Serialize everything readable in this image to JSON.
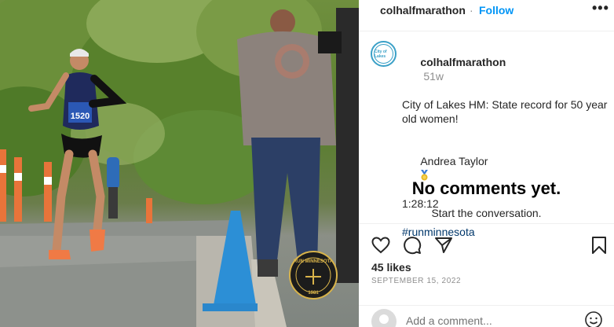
{
  "post": {
    "author": "colhalfmarathon",
    "separator": "·",
    "follow_label": "Follow",
    "more_label": "•••",
    "avatar_text": "City of Lakes",
    "caption_username": "colhalfmarathon",
    "time_ago": "51w",
    "caption_line1": "City of Lakes HM: State record for 50 year old women!",
    "caption_name": "Andrea Taylor",
    "caption_time": "1:28:12",
    "hashtag": "#runminnesota",
    "no_comments_title": "No comments yet.",
    "no_comments_sub": "Start the conversation.",
    "likes": "45 likes",
    "date": "SEPTEMBER 15, 2022",
    "comment_placeholder": "Add a comment..."
  },
  "photo": {
    "bib_number": "1520",
    "watermark_top": "RUN MINNESOTA",
    "watermark_year": "1981"
  },
  "icons": {
    "like": "heart-icon",
    "comment": "comment-icon",
    "share": "paper-plane-icon",
    "save": "bookmark-icon",
    "emoji": "smiley-icon",
    "more": "more-icon"
  },
  "colors": {
    "follow_blue": "#0095f6",
    "hashtag_blue": "#00376b",
    "muted_gray": "#8e8e8e",
    "watermark_gold": "#d8b34a"
  }
}
